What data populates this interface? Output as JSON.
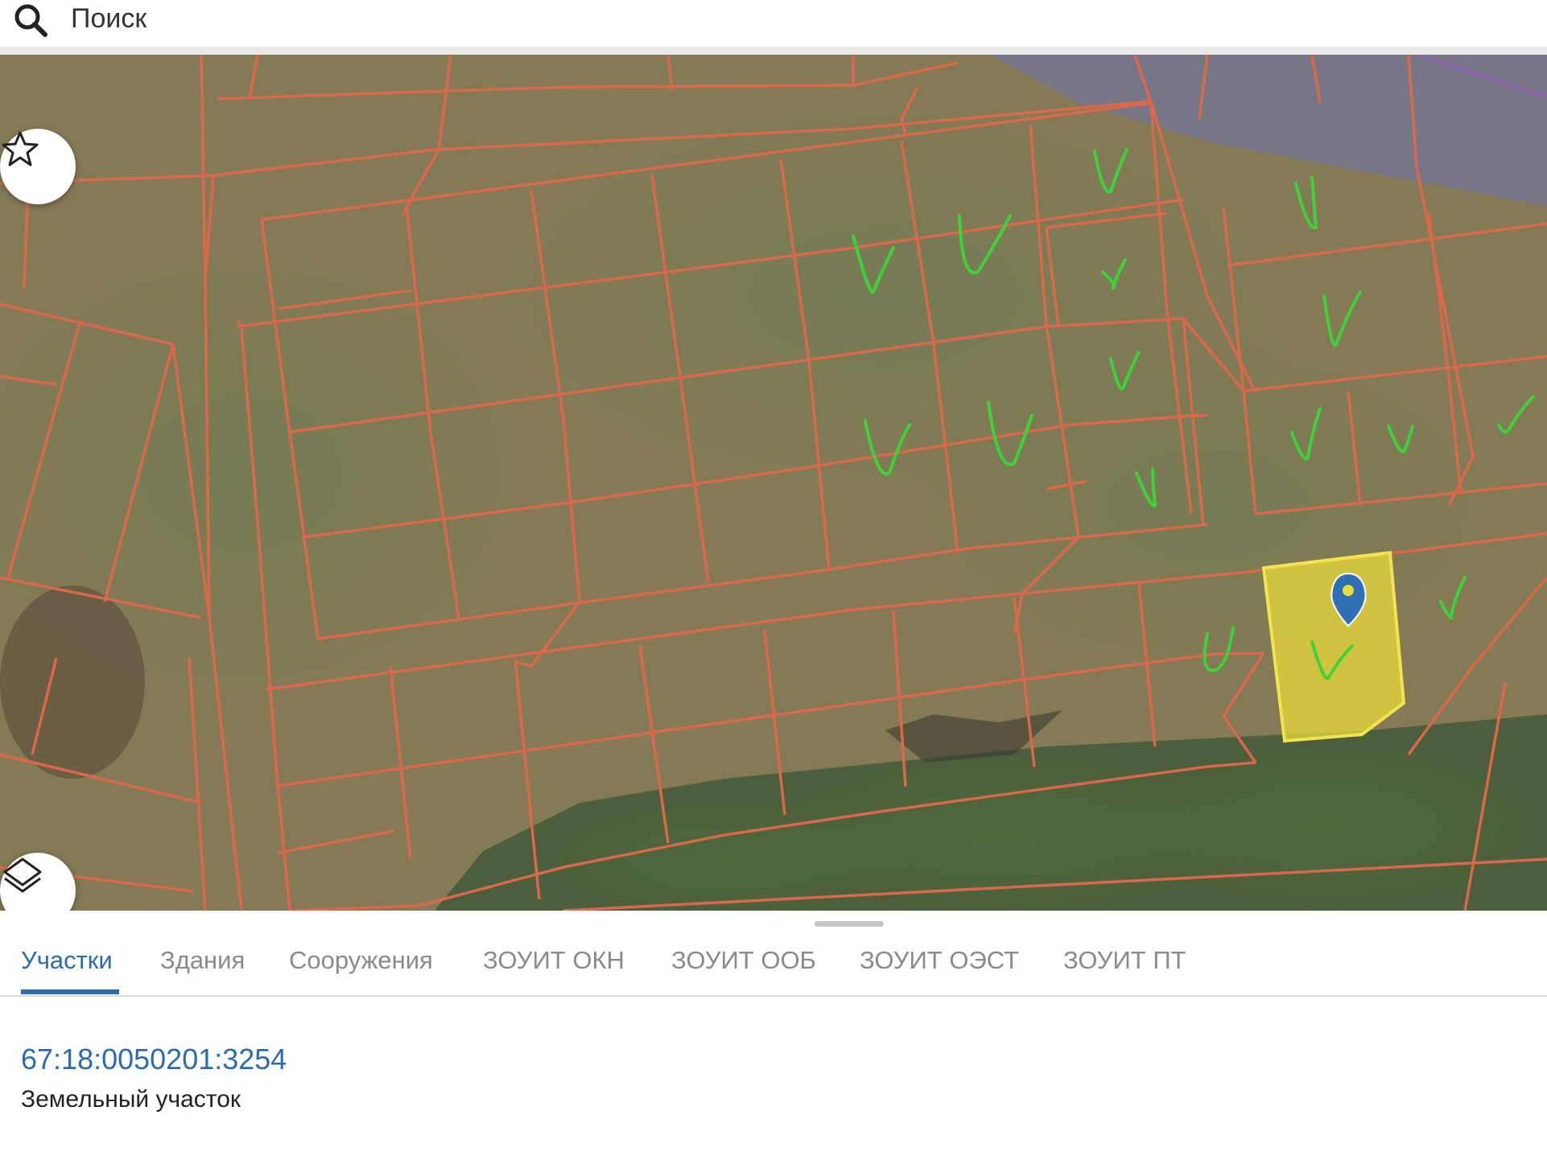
{
  "search": {
    "placeholder": "Поиск"
  },
  "map": {
    "parcel_line_color": "#d9694a",
    "check_mark_color": "#3ed13a",
    "selected_parcel_fill": "#e8dc3a",
    "marker_color": "#2f6fb5",
    "buttons": {
      "favorite_icon": "star-icon",
      "layers_icon": "layers-icon"
    }
  },
  "tabs": [
    {
      "label": "Участки",
      "active": true
    },
    {
      "label": "Здания",
      "active": false
    },
    {
      "label": "Сооружения",
      "active": false
    },
    {
      "label": "ЗОУИТ ОКН",
      "active": false
    },
    {
      "label": "ЗОУИТ ООБ",
      "active": false
    },
    {
      "label": "ЗОУИТ ОЭСТ",
      "active": false
    },
    {
      "label": "ЗОУИТ ПТ",
      "active": false
    }
  ],
  "result": {
    "cadastral_number": "67:18:0050201:3254",
    "type": "Земельный участок"
  },
  "colors": {
    "accent": "#2b6cb0",
    "inactive_tab": "#8a8a8a"
  }
}
